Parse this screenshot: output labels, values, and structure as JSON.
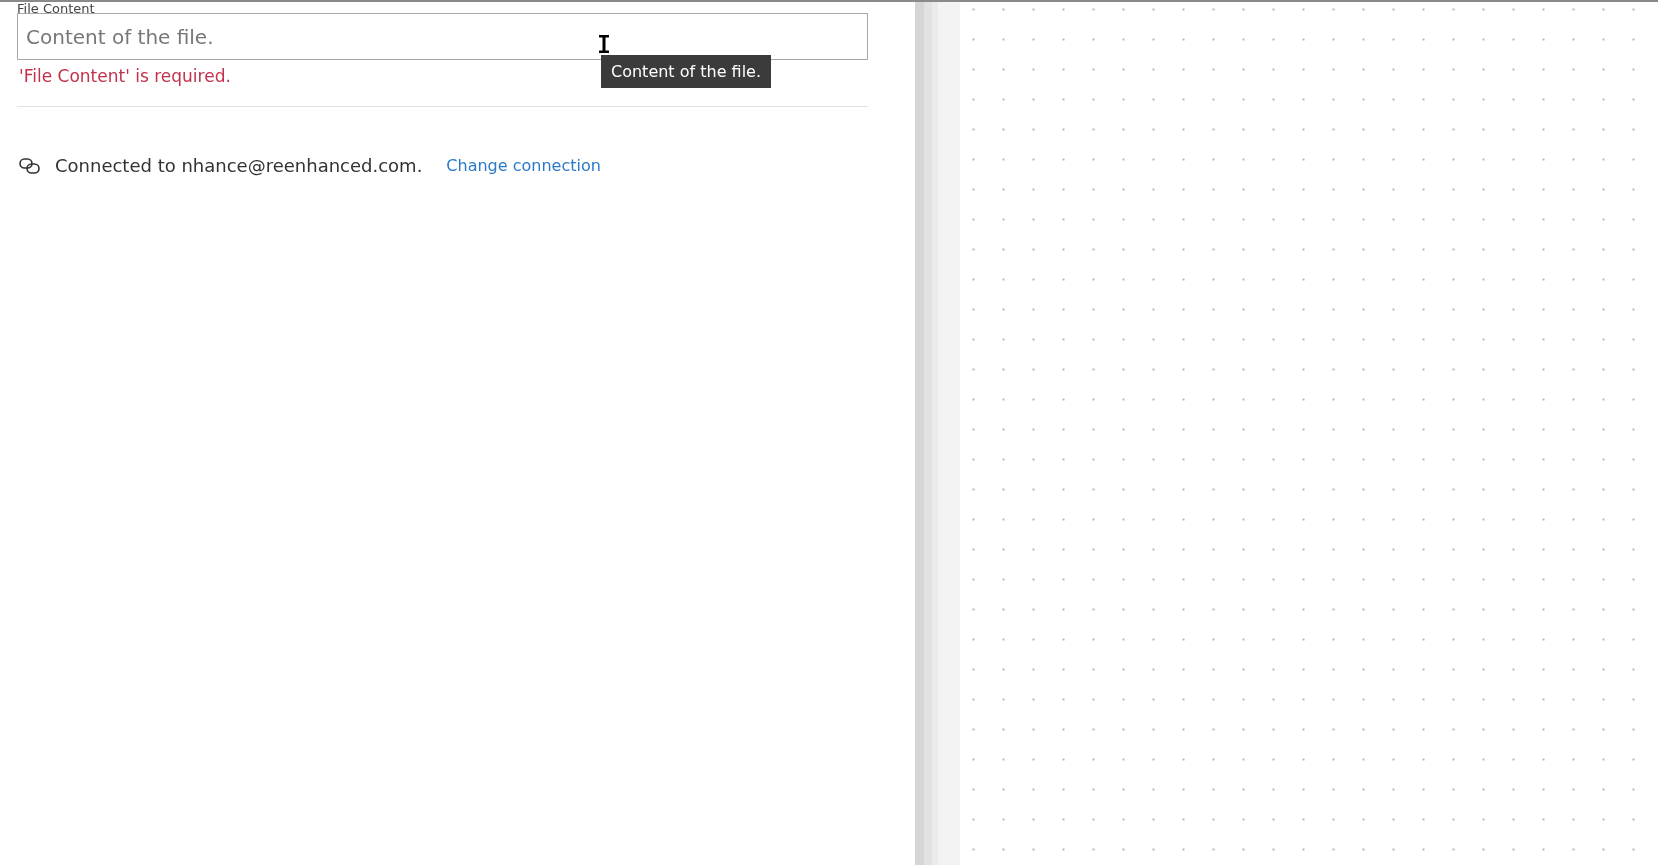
{
  "field": {
    "label": "File Content",
    "placeholder": "Content of the file.",
    "error": "'File Content' is required.",
    "tooltip": "Content of the file."
  },
  "connection": {
    "text": "Connected to nhance@reenhanced.com.",
    "link": "Change connection"
  }
}
